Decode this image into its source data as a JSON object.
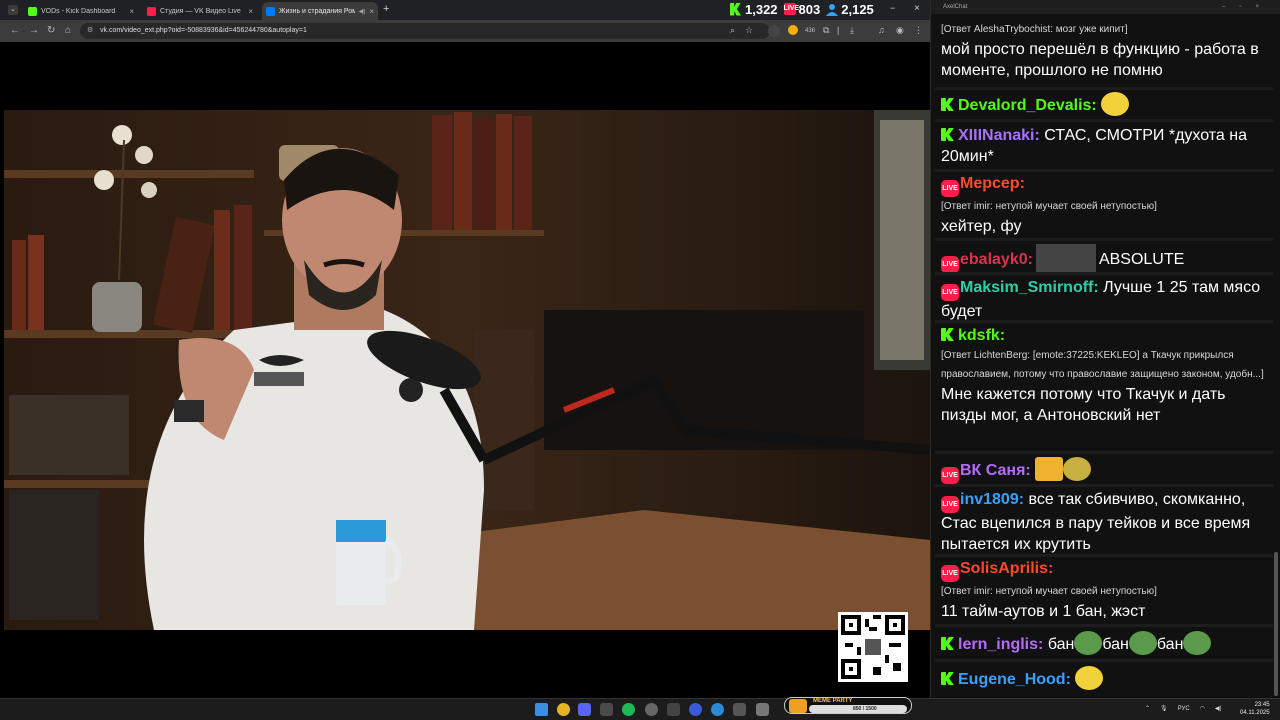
{
  "browser": {
    "tabs": [
      {
        "title": "VODs - Kick Dashboard",
        "active": false
      },
      {
        "title": "Студия — VK Видео Live",
        "active": false
      },
      {
        "title": "Жизнь и страдания Роман",
        "active": true
      }
    ],
    "url": "vk.com/video_ext.php?oid=-50883936&id=456244780&autoplay=1",
    "extension_badge": "436"
  },
  "stats": {
    "kick_viewers": "1,322",
    "vk_viewers": "803",
    "total_viewers": "2,125",
    "vk_badge": "LIVE"
  },
  "chat": {
    "window_title": "AxelChat",
    "messages": [
      {
        "platform": "none",
        "user": "",
        "reply": "[Ответ AleshaTrybochist: мозг уже кипит]",
        "text": "мой просто перешёл в функцию - работа в моменте, прошлого не помню",
        "color": "#ffffff"
      },
      {
        "platform": "kick",
        "user": "Devalord_Devalis:",
        "reply": "",
        "text": "",
        "color": "#53fc18",
        "emotes": [
          "pepe-emote"
        ]
      },
      {
        "platform": "kick",
        "user": "XIIINanaki:",
        "reply": "",
        "text": "СТАС, СМОТРИ *духота на 20мин*",
        "color": "#a970ff"
      },
      {
        "platform": "vk",
        "user": "Мерсер:",
        "reply": "[Ответ imir: нетупой мучает своей нетупостью]",
        "text": "хейтер, фу",
        "color": "#ff4a2a"
      },
      {
        "platform": "vk",
        "user": "ebalayk0:",
        "reply": "",
        "text": "ABSOLUTE",
        "color": "#d8344b"
      },
      {
        "platform": "vk",
        "user": "Maksim_Smirnoff:",
        "reply": "",
        "text": "Лучше 1 25 там мясо будет",
        "color": "#2ad1a8"
      },
      {
        "platform": "kick",
        "user": "kdsfk:",
        "reply": "[Ответ LichtenBerg: [emote:37225:KEKLEO] а Ткачук прикрылся православием, потому что православие защищено законом, удобн...]",
        "text": "Мне кажется потому что Ткачук и дать пизды мог, а Антоновский нет",
        "color": "#53fc18"
      },
      {
        "platform": "vk",
        "user": "ВК Саня:",
        "reply": "",
        "text": "",
        "color": "#b46cff",
        "emotes": [
          "beer-emote",
          "pepe-emote"
        ]
      },
      {
        "platform": "vk",
        "user": "inv1809:",
        "reply": "",
        "text": "все так сбивчиво, скомканно, Стас вцепился в пару тейков и все время пытается их крутить",
        "color": "#3aa0ff"
      },
      {
        "platform": "vk",
        "user": "SolisAprilis:",
        "reply": "[Ответ imir: нетупой мучает своей нетупостью]",
        "text": "11 тайм-аутов и 1 бан, жэст",
        "color": "#ff4a2a"
      },
      {
        "platform": "kick",
        "user": "lern_inglis:",
        "reply": "",
        "text_parts": [
          "бан",
          "бан",
          "бан"
        ],
        "color": "#b46cff"
      },
      {
        "platform": "kick",
        "user": "Eugene_Hood:",
        "reply": "",
        "text": "",
        "color": "#3aa0ff",
        "emotes": [
          "pepe-emote"
        ]
      }
    ]
  },
  "taskbar": {
    "lang": "РУС",
    "time": "23:45",
    "date": "04.11.2025",
    "meme_party_label": "MEME PARTY",
    "meme_party_progress": "850 / 1500"
  }
}
